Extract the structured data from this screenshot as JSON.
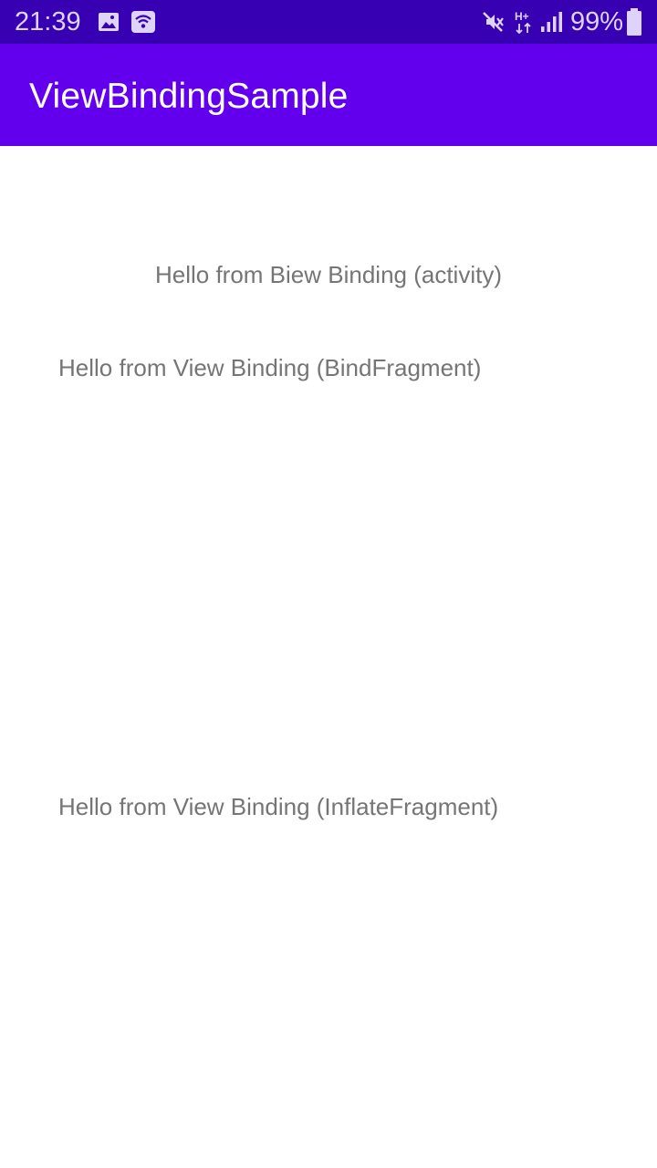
{
  "status_bar": {
    "time": "21:39",
    "battery_percent": "99%",
    "icons": [
      "image-icon",
      "wifi-call-icon",
      "mute-icon",
      "h-plus-data-icon",
      "signal-icon",
      "battery-icon"
    ],
    "background": "#3700b3"
  },
  "app_bar": {
    "title": "ViewBindingSample",
    "background": "#6200ee"
  },
  "content": {
    "activity_text": "Hello from Biew Binding (activity)",
    "bind_fragment_text": "Hello from View Binding (BindFragment)",
    "inflate_fragment_text": "Hello from View Binding (InflateFragment)"
  }
}
